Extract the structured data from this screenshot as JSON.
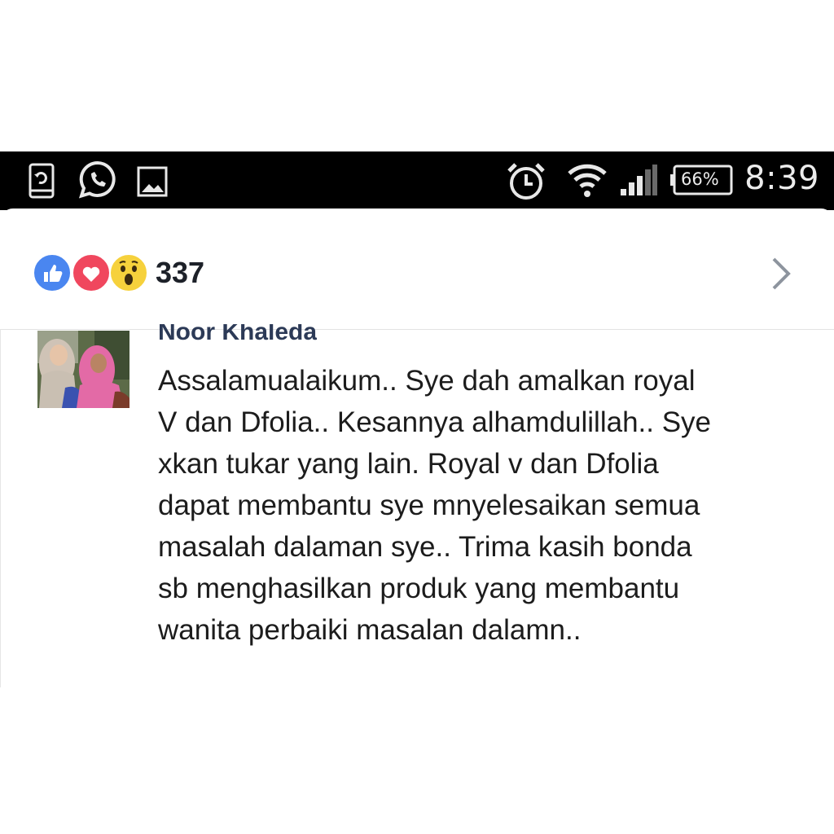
{
  "status_bar": {
    "time": "8:39",
    "battery": "66%",
    "icons_left": [
      "screen-record-icon",
      "whatsapp-icon",
      "gallery-icon"
    ],
    "icons_right": [
      "alarm-icon",
      "wifi-icon",
      "signal-icon",
      "battery-icon"
    ]
  },
  "reactions": {
    "types": [
      "like",
      "love",
      "wow"
    ],
    "count": "337",
    "colors": {
      "like": "#4a86f0",
      "love": "#f0475e",
      "wow": "#f6d13c"
    }
  },
  "comment": {
    "author": "Noor Khaleda",
    "lines": [
      "Assalamualaikum.. Sye dah amalkan royal",
      "V dan Dfolia.. Kesannya alhamdulillah.. Sye",
      "xkan tukar yang lain. Royal v dan Dfolia",
      "dapat membantu sye mnyelesaikan semua",
      "masalah dalaman sye.. Trima kasih bonda",
      "sb menghasilkan produk yang membantu",
      "wanita perbaiki masalan dalamn.."
    ]
  }
}
